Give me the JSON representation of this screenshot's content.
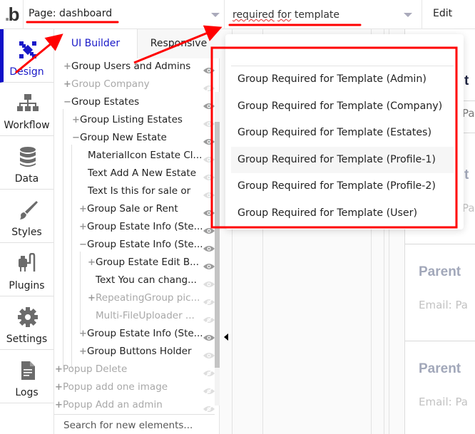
{
  "topbar": {
    "logo_main": "b",
    "logo_dot": ".",
    "page_select_label": "Page: dashboard",
    "element_search_value_words": [
      "required",
      "for",
      "template"
    ],
    "edit_label": "Edit"
  },
  "leftnav": {
    "items": [
      {
        "label": "Design",
        "icon": "design-icon",
        "active": true
      },
      {
        "label": "Workflow",
        "icon": "workflow-icon"
      },
      {
        "label": "Data",
        "icon": "database-icon"
      },
      {
        "label": "Styles",
        "icon": "brush-icon"
      },
      {
        "label": "Plugins",
        "icon": "plug-icon"
      },
      {
        "label": "Settings",
        "icon": "gear-icon"
      },
      {
        "label": "Logs",
        "icon": "document-icon"
      }
    ]
  },
  "panel": {
    "tabs": [
      {
        "label": "UI Builder",
        "active": true
      },
      {
        "label": "Responsive",
        "active": false
      }
    ],
    "tree": [
      {
        "label": "Group Users and Admins",
        "toggle": "+",
        "visible": true
      },
      {
        "label": "Group Company",
        "toggle": "+",
        "visible": false
      },
      {
        "label": "Group Estates",
        "toggle": "−",
        "visible": true
      },
      {
        "label": "Group Listing Estates",
        "toggle": "+",
        "visible": false
      },
      {
        "label": "Group New Estate",
        "toggle": "−",
        "visible": true
      },
      {
        "label": "MaterialIcon Estate Cl...",
        "toggle": "",
        "visible": false
      },
      {
        "label": "Text Add A New Estate",
        "toggle": "",
        "visible": false
      },
      {
        "label": "Text Is this for sale or",
        "toggle": "",
        "visible": false
      },
      {
        "label": "Group Sale or Rent",
        "toggle": "+",
        "visible": true
      },
      {
        "label": "Group Estate Info (Ste...",
        "toggle": "+",
        "visible": true
      },
      {
        "label": "Group Estate Info (Ste...",
        "toggle": "−",
        "visible": true
      },
      {
        "label": "Group Estate Edit B...",
        "toggle": "+",
        "visible": true
      },
      {
        "label": "Text You can chang...",
        "toggle": "",
        "visible": false
      },
      {
        "label": "RepeatingGroup pic...",
        "toggle": "+",
        "visible": false
      },
      {
        "label": "Multi-FileUploader ...",
        "toggle": "",
        "visible": false
      },
      {
        "label": "Group Estate Info (Ste...",
        "toggle": "+",
        "visible": true
      },
      {
        "label": "Group Buttons Holder",
        "toggle": "+",
        "visible": false
      },
      {
        "label": "Popup Delete",
        "toggle": "+",
        "visible": false
      },
      {
        "label": "Popup add one image",
        "toggle": "+",
        "visible": false
      },
      {
        "label": "Popup Add an admin",
        "toggle": "+",
        "visible": false
      }
    ],
    "search_placeholder": "Search for new elements..."
  },
  "dropdown": {
    "items": [
      "Group Required for Template (Admin)",
      "Group Required for Template (Company)",
      "Group Required for Template (Estates)",
      "Group Required for Template (Profile-1)",
      "Group Required for Template (Profile-2)",
      "Group Required for Template (User)"
    ],
    "hovered_index": 3
  },
  "canvas": {
    "cards": [
      {
        "title": "Parent",
        "email": "Email: Pa"
      },
      {
        "title": "Parent",
        "email": "Email: Pa"
      }
    ],
    "partial_title_1": "t",
    "partial_text_1": "Pa",
    "partial_title_2": "t",
    "partial_text_2": "Pa"
  },
  "colors": {
    "accent": "#1a1ac8",
    "annotation": "#ff0000"
  }
}
